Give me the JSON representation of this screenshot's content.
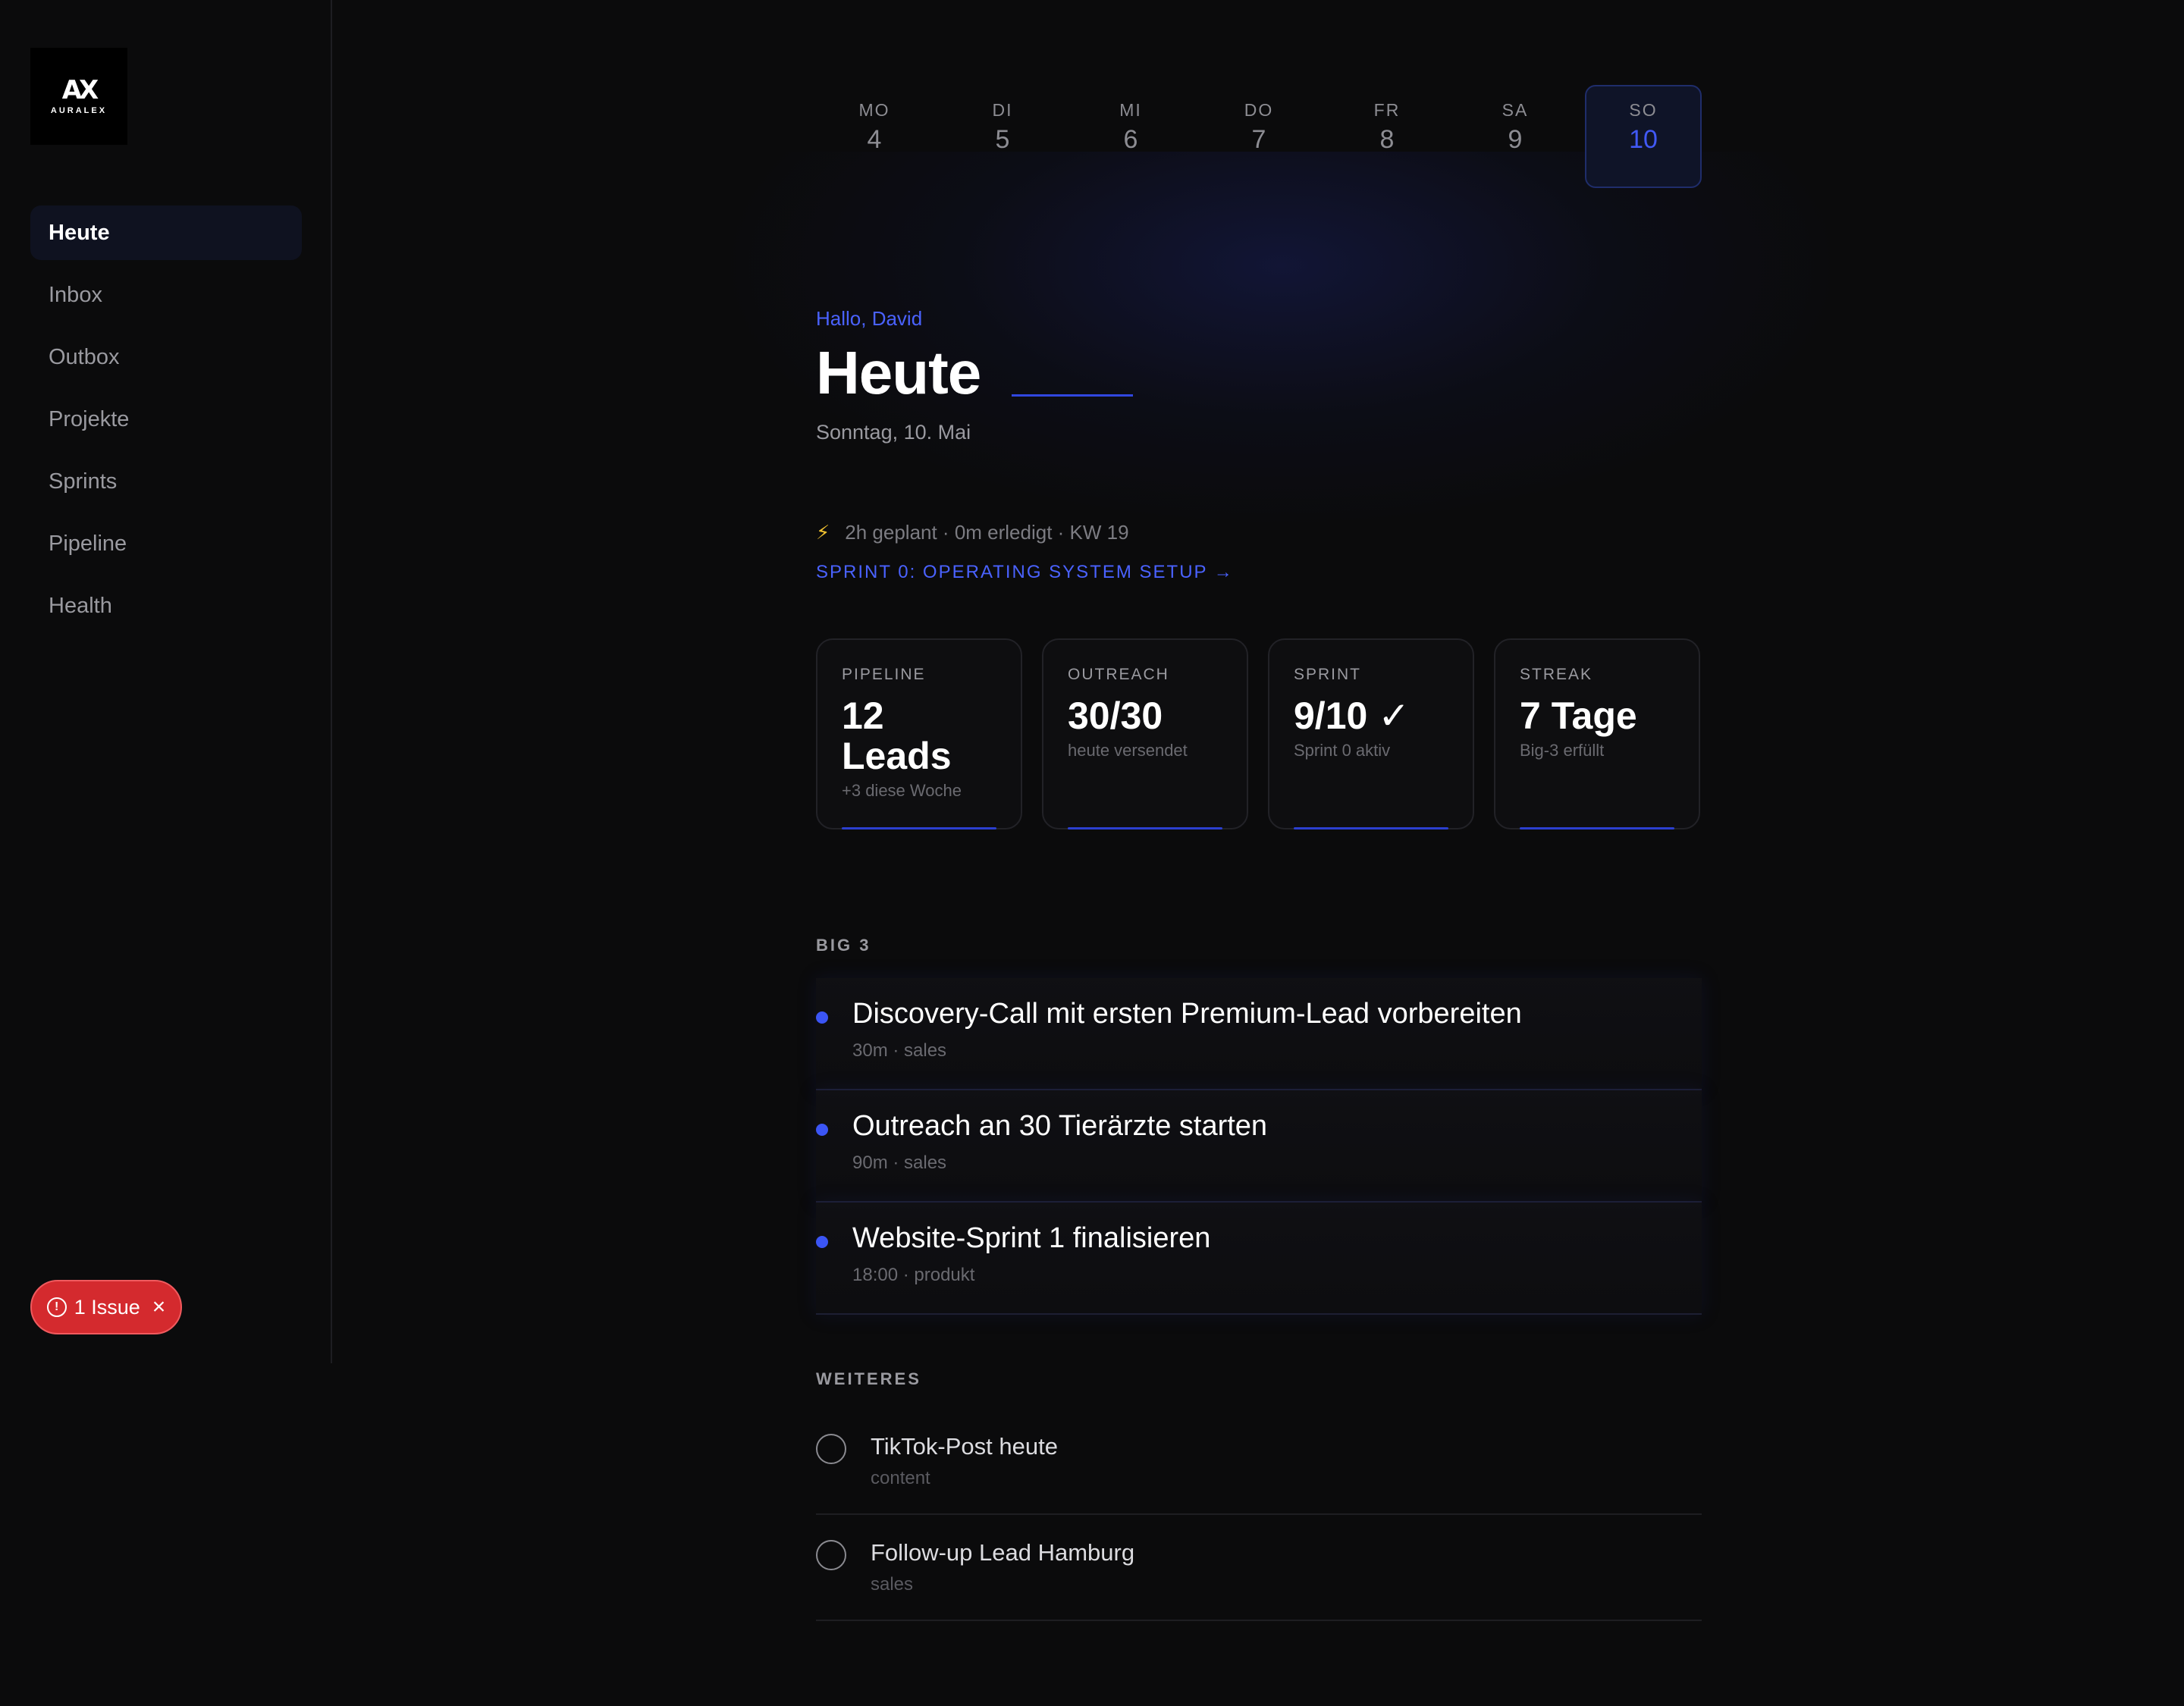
{
  "brand": {
    "logo_mark": "AX",
    "logo_text": "AURALEX"
  },
  "sidebar": {
    "items": [
      {
        "label": "Heute",
        "active": true
      },
      {
        "label": "Inbox"
      },
      {
        "label": "Outbox"
      },
      {
        "label": "Projekte"
      },
      {
        "label": "Sprints"
      },
      {
        "label": "Pipeline"
      },
      {
        "label": "Health"
      }
    ]
  },
  "issue_badge": {
    "label": "1 Issue",
    "icon": "alert-circle-icon",
    "close_icon": "close-icon",
    "color": "#d42a2e"
  },
  "week": [
    {
      "name": "MO",
      "num": "4"
    },
    {
      "name": "DI",
      "num": "5"
    },
    {
      "name": "MI",
      "num": "6"
    },
    {
      "name": "DO",
      "num": "7"
    },
    {
      "name": "FR",
      "num": "8"
    },
    {
      "name": "SA",
      "num": "9"
    },
    {
      "name": "SO",
      "num": "10",
      "active": true
    }
  ],
  "header": {
    "greeting": "Hallo, David",
    "title": "Heute",
    "date": "Sonntag, 10. Mai"
  },
  "meta": {
    "bolt_icon": "⚡",
    "text": "2h geplant · 0m erledigt · KW 19",
    "sprint_link": "SPRINT 0: OPERATING SYSTEM SETUP →"
  },
  "cards": [
    {
      "label": "PIPELINE",
      "value": "12 Leads",
      "sub": "+3 diese Woche"
    },
    {
      "label": "OUTREACH",
      "value": "30/30",
      "sub": "heute versendet"
    },
    {
      "label": "SPRINT",
      "value": "9/10 ✓",
      "sub": "Sprint 0 aktiv"
    },
    {
      "label": "STREAK",
      "value": "7 Tage",
      "sub": "Big-3 erfüllt"
    }
  ],
  "big3": {
    "label": "BIG 3",
    "items": [
      {
        "title": "Discovery-Call mit ersten Premium-Lead vorbereiten",
        "sub": "30m · sales"
      },
      {
        "title": "Outreach an 30 Tierärzte starten",
        "sub": "90m · sales"
      },
      {
        "title": "Website-Sprint 1 finalisieren",
        "sub": "18:00 · produkt"
      }
    ]
  },
  "weiteres": {
    "label": "WEITERES",
    "items": [
      {
        "title": "TikTok-Post heute",
        "sub": "content"
      },
      {
        "title": "Follow-up Lead Hamburg",
        "sub": "sales"
      }
    ]
  },
  "colors": {
    "accent": "#4159f5",
    "background": "#0b0b0c",
    "danger": "#d42a2e"
  }
}
